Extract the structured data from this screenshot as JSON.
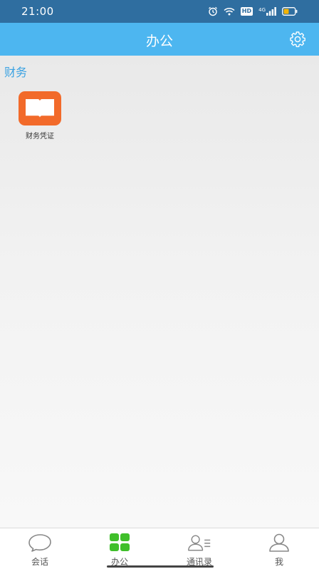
{
  "status_bar": {
    "time": "21:00",
    "icons": [
      "alarm-icon",
      "wifi-icon",
      "hd-icon",
      "signal-4g-icon",
      "battery-icon"
    ],
    "hd_text": "HD",
    "network_text": "4G"
  },
  "header": {
    "title": "办公",
    "settings_icon": "gear-icon"
  },
  "sections": [
    {
      "title": "财务",
      "apps": [
        {
          "label": "财务凭证",
          "icon": "book-icon",
          "color": "#f26a2a"
        }
      ]
    }
  ],
  "tab_bar": {
    "active_index": 1,
    "active_color": "#3fbf2a",
    "tabs": [
      {
        "label": "会话",
        "icon": "chat-bubble-icon"
      },
      {
        "label": "办公",
        "icon": "grid-apps-icon"
      },
      {
        "label": "通讯录",
        "icon": "contacts-icon"
      },
      {
        "label": "我",
        "icon": "person-icon"
      }
    ]
  },
  "colors": {
    "status_bar": "#2f6ea0",
    "header": "#4db6f0",
    "section_title": "#3aa2e2"
  }
}
